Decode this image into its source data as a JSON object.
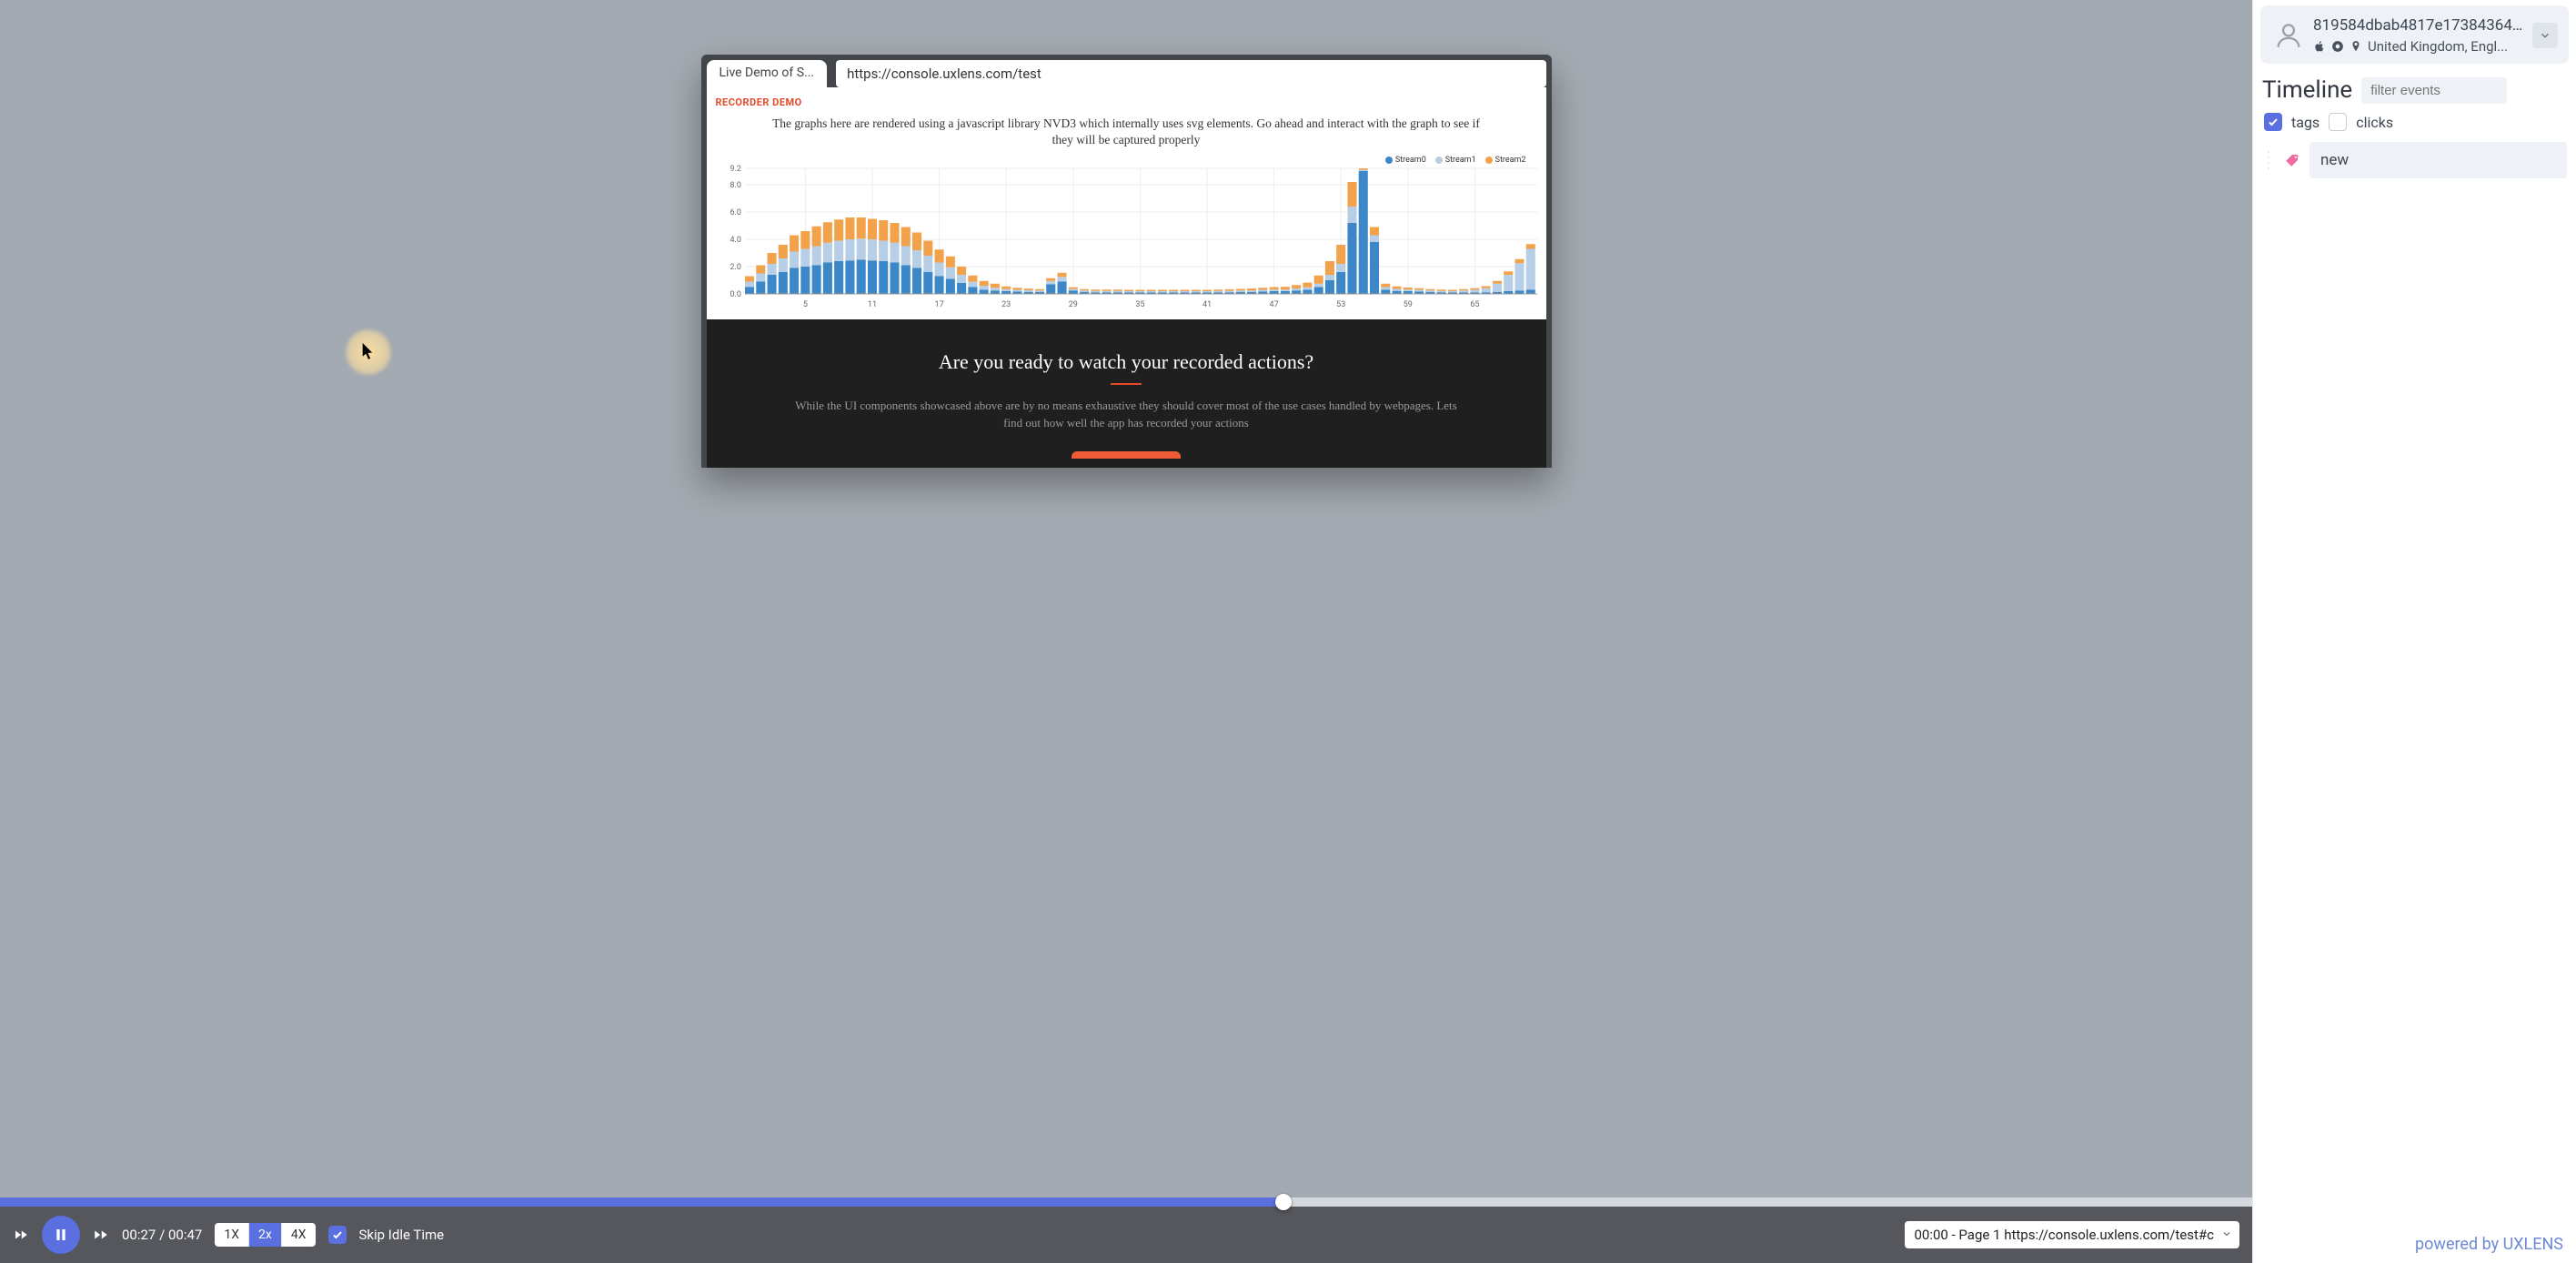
{
  "browser": {
    "tab_title": "Live Demo of S...",
    "url": "https://console.uxlens.com/test"
  },
  "recorder_label": "RECORDER DEMO",
  "graph_caption": "The graphs here are rendered using a javascript library NVD3 which internally uses svg elements. Go ahead and interact with the graph to see if they will be captured properly",
  "legend": {
    "s0": "Stream0",
    "s1": "Stream1",
    "s2": "Stream2"
  },
  "cta": {
    "title": "Are you ready to watch your recorded actions?",
    "sub": "While the UI components showcased above are by no means exhaustive they should cover most of the use cases handled by webpages. Lets find out how well the app has recorded your actions"
  },
  "playbar": {
    "time_current": "00:27",
    "time_total": "00:47",
    "percent": 57,
    "speeds": {
      "x1": "1X",
      "x2": "2x",
      "x4": "4X"
    },
    "skip_idle_label": "Skip Idle Time",
    "page_select": "00:00 - Page 1 https://console.uxlens.com/test#c"
  },
  "sidebar": {
    "user_id": "819584dbab4817e17384364...",
    "location": "United Kingdom, Engl...",
    "timeline_title": "Timeline",
    "filter_placeholder": "filter events",
    "tags_label": "tags",
    "clicks_label": "clicks",
    "event_new": "new"
  },
  "powered": "powered by UXLENS",
  "chart_data": {
    "type": "bar",
    "title": "",
    "xlabel": "",
    "ylabel": "",
    "ylim": [
      0,
      9.2
    ],
    "y_ticks": [
      0.0,
      2.0,
      4.0,
      6.0,
      8.0,
      9.2
    ],
    "x_ticks": [
      5,
      11,
      17,
      23,
      29,
      35,
      41,
      47,
      53,
      59,
      65
    ],
    "x": [
      0,
      1,
      2,
      3,
      4,
      5,
      6,
      7,
      8,
      9,
      10,
      11,
      12,
      13,
      14,
      15,
      16,
      17,
      18,
      19,
      20,
      21,
      22,
      23,
      24,
      25,
      26,
      27,
      28,
      29,
      30,
      31,
      32,
      33,
      34,
      35,
      36,
      37,
      38,
      39,
      40,
      41,
      42,
      43,
      44,
      45,
      46,
      47,
      48,
      49,
      50,
      51,
      52,
      53,
      54,
      55,
      56,
      57,
      58,
      59,
      60,
      61,
      62,
      63,
      64,
      65,
      66,
      67,
      68,
      69,
      70
    ],
    "series": [
      {
        "name": "Stream0",
        "color": "#3b87c8",
        "values": [
          0.5,
          0.9,
          1.4,
          1.6,
          1.9,
          2.0,
          2.1,
          2.3,
          2.4,
          2.45,
          2.5,
          2.45,
          2.4,
          2.3,
          2.1,
          1.9,
          1.6,
          1.3,
          1.1,
          0.8,
          0.5,
          0.3,
          0.25,
          0.2,
          0.18,
          0.15,
          0.15,
          0.7,
          0.9,
          0.25,
          0.15,
          0.12,
          0.12,
          0.12,
          0.1,
          0.1,
          0.1,
          0.1,
          0.1,
          0.1,
          0.1,
          0.1,
          0.12,
          0.12,
          0.15,
          0.15,
          0.18,
          0.2,
          0.2,
          0.25,
          0.3,
          0.5,
          1.0,
          1.6,
          5.2,
          9.0,
          3.8,
          0.3,
          0.22,
          0.2,
          0.18,
          0.15,
          0.12,
          0.1,
          0.1,
          0.1,
          0.12,
          0.15,
          0.2,
          0.25,
          0.3
        ]
      },
      {
        "name": "Stream1",
        "color": "#b6cee6",
        "values": [
          0.4,
          0.6,
          0.8,
          1.0,
          1.2,
          1.3,
          1.4,
          1.45,
          1.5,
          1.55,
          1.55,
          1.55,
          1.5,
          1.45,
          1.4,
          1.3,
          1.2,
          1.0,
          0.85,
          0.6,
          0.4,
          0.3,
          0.2,
          0.15,
          0.12,
          0.12,
          0.1,
          0.25,
          0.35,
          0.12,
          0.1,
          0.1,
          0.1,
          0.1,
          0.1,
          0.1,
          0.1,
          0.1,
          0.1,
          0.1,
          0.1,
          0.1,
          0.1,
          0.1,
          0.1,
          0.1,
          0.12,
          0.12,
          0.12,
          0.15,
          0.18,
          0.25,
          0.4,
          0.6,
          1.2,
          0.1,
          0.5,
          0.2,
          0.15,
          0.12,
          0.12,
          0.1,
          0.1,
          0.1,
          0.15,
          0.2,
          0.3,
          0.6,
          1.2,
          2.0,
          3.0
        ]
      },
      {
        "name": "Stream2",
        "color": "#f2a24a",
        "values": [
          0.4,
          0.6,
          0.8,
          1.0,
          1.2,
          1.3,
          1.45,
          1.5,
          1.55,
          1.6,
          1.55,
          1.5,
          1.5,
          1.45,
          1.4,
          1.3,
          1.1,
          0.95,
          0.8,
          0.6,
          0.45,
          0.35,
          0.3,
          0.2,
          0.15,
          0.12,
          0.1,
          0.2,
          0.3,
          0.12,
          0.1,
          0.1,
          0.1,
          0.1,
          0.1,
          0.1,
          0.1,
          0.1,
          0.1,
          0.1,
          0.1,
          0.1,
          0.1,
          0.12,
          0.12,
          0.15,
          0.15,
          0.18,
          0.2,
          0.25,
          0.35,
          0.6,
          1.0,
          1.4,
          1.8,
          0.1,
          0.6,
          0.25,
          0.18,
          0.15,
          0.12,
          0.1,
          0.1,
          0.1,
          0.1,
          0.12,
          0.15,
          0.2,
          0.25,
          0.3,
          0.35
        ]
      }
    ]
  }
}
